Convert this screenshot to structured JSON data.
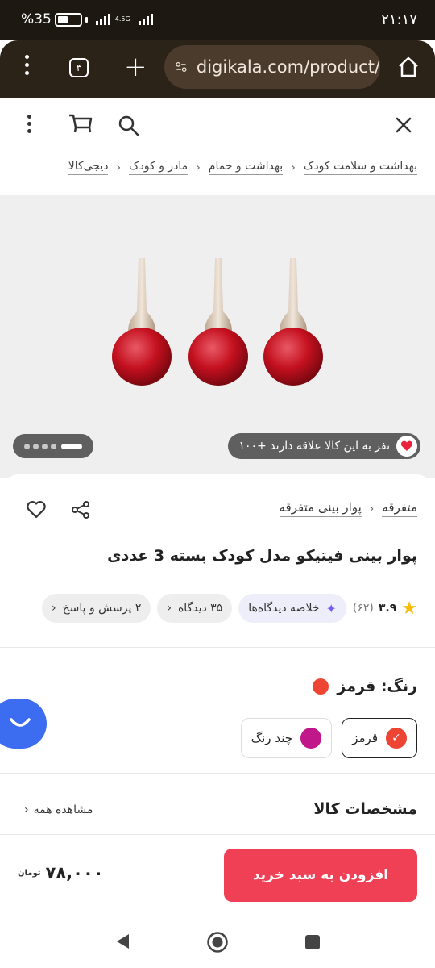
{
  "status_bar": {
    "time": "۲۱:۱۷",
    "battery": "%35",
    "network": "4.5G"
  },
  "browser": {
    "url": "digikala.com/product/",
    "tab_count": "۳"
  },
  "breadcrumb": [
    "دیجی‌کالا",
    "مادر و کودک",
    "بهداشت و حمام",
    "بهداشت و سلامت کودک"
  ],
  "gallery": {
    "likes_text": "۱۰۰+ نفر به این کالا علاقه دارند"
  },
  "product": {
    "category_path": [
      "متفرقه",
      "پوار بینی متفرقه"
    ],
    "title": "پوار بینی فیتیکو مدل کودک بسته 3 عددی",
    "rating": "۳.۹",
    "rating_count": "(۶۲)",
    "review_summary": "خلاصه دیدگاه‌ها",
    "reviews": "۳۵ دیدگاه",
    "qa": "۲ پرسش و پاسخ"
  },
  "color": {
    "label": "رنگ: قرمز",
    "options": [
      {
        "name": "قرمز",
        "color": "#ee4433",
        "selected": true
      },
      {
        "name": "چند رنگ",
        "color": "#c0188a",
        "selected": false
      }
    ]
  },
  "specs": {
    "title": "مشخصات کالا",
    "see_all": "مشاهده همه"
  },
  "buy": {
    "button": "افزودن به سبد خرید",
    "price": "۷۸,۰۰۰",
    "currency": "تومان"
  },
  "colors": {
    "accent": "#ef4056",
    "chat": "#3c6df0"
  }
}
